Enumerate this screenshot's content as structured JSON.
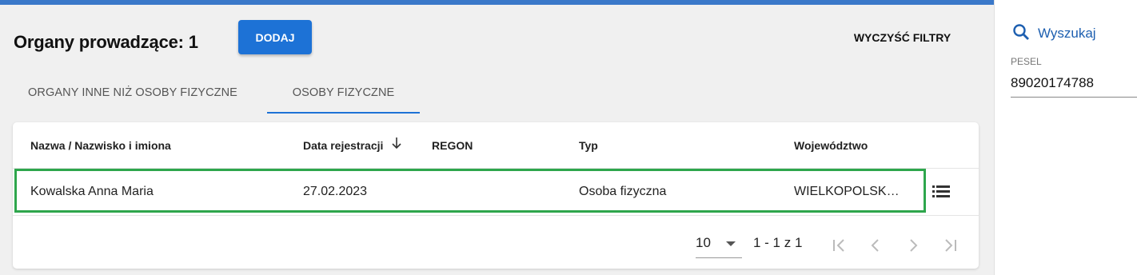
{
  "header": {
    "title": "Organy prowadzące: 1",
    "add_label": "DODAJ",
    "clear_filters_label": "WYCZYŚĆ FILTRY"
  },
  "tabs": [
    {
      "label": "ORGANY INNE NIŻ OSOBY FIZYCZNE",
      "active": false
    },
    {
      "label": "OSOBY FIZYCZNE",
      "active": true
    }
  ],
  "table": {
    "columns": [
      "Nazwa / Nazwisko i imiona",
      "Data rejestracji",
      "REGON",
      "Typ",
      "Województwo"
    ],
    "sort_icon": "arrow-down-icon",
    "rows": [
      {
        "name": "Kowalska Anna Maria",
        "date": "27.02.2023",
        "regon": "",
        "type": "Osoba fizyczna",
        "voivodeship": "WIELKOPOLSK…"
      }
    ]
  },
  "pagination": {
    "page_size": "10",
    "range_label": "1 - 1 z 1"
  },
  "sidebar": {
    "search_label": "Wyszukaj",
    "pesel_label": "PESEL",
    "pesel_value": "89020174788"
  },
  "colors": {
    "accent": "#1d72d6",
    "top_bar": "#3a78c9",
    "highlight": "#2ea64c"
  }
}
